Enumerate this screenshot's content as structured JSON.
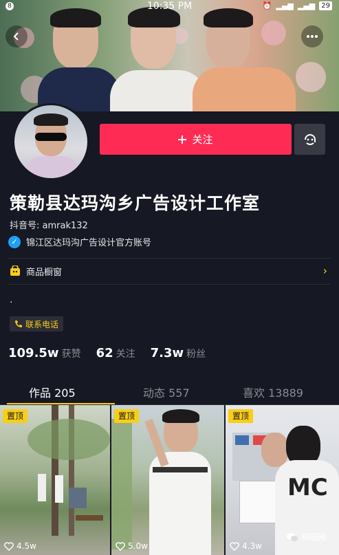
{
  "status_bar": {
    "notification_badge": "8",
    "time": "10:35 PM",
    "battery": "29"
  },
  "profile": {
    "follow_label": "关注",
    "name": "策勒县达玛沟乡广告设计工作室",
    "douyin_id": "抖音号: amrak132",
    "verified_text": "锦江区达玛沟广告设计官方账号",
    "shop_label": "商品橱窗",
    "bio": ".",
    "contact_label": "联系电话"
  },
  "stats": [
    {
      "value": "109.5w",
      "label": "获赞"
    },
    {
      "value": "62",
      "label": "关注"
    },
    {
      "value": "7.3w",
      "label": "粉丝"
    }
  ],
  "tabs": [
    {
      "label": "作品 205",
      "active": true
    },
    {
      "label": "动态 557",
      "active": false
    },
    {
      "label": "喜欢 13889",
      "active": false
    }
  ],
  "videos": [
    {
      "pin": "置顶",
      "likes": "4.5w"
    },
    {
      "pin": "置顶",
      "likes": "5.0w"
    },
    {
      "pin": "置顶",
      "likes": "4.3w"
    }
  ],
  "watermark": "和田网",
  "colors": {
    "background": "#161823",
    "follow_button": "#fe2c55",
    "accent_yellow": "#face15",
    "verified_blue": "#20a0f5"
  },
  "icons": [
    "back-icon",
    "more-icon",
    "plus-icon",
    "message-icon",
    "verified-icon",
    "shop-icon",
    "chevron-right-icon",
    "phone-icon",
    "heart-icon",
    "wechat-icon"
  ]
}
